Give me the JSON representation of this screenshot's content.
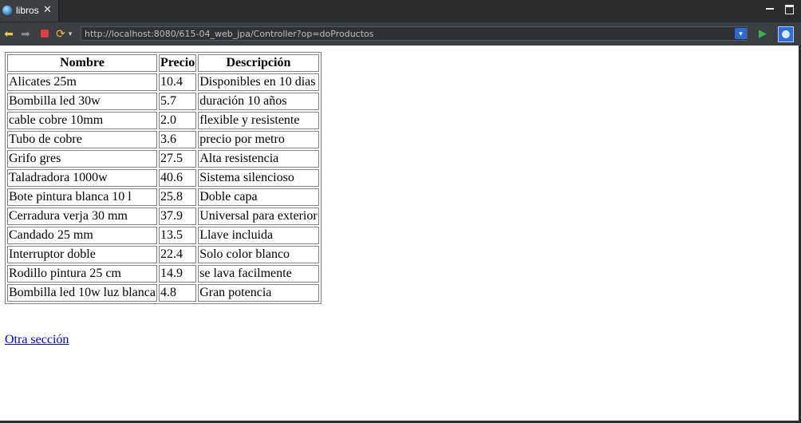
{
  "tab": {
    "title": "libros",
    "close": "✕"
  },
  "toolbar": {
    "url": "http://localhost:8080/615-04_web_jpa/Controller?op=doProductos"
  },
  "table": {
    "headers": [
      "Nombre",
      "Precio",
      "Descripción"
    ],
    "rows": [
      [
        "Alicates 25m",
        "10.4",
        "Disponibles en 10 dias"
      ],
      [
        "Bombilla led 30w",
        "5.7",
        "duración 10 años"
      ],
      [
        "cable cobre 10mm",
        "2.0",
        "flexible y resistente"
      ],
      [
        "Tubo de cobre",
        "3.6",
        "precio por metro"
      ],
      [
        "Grifo gres",
        "27.5",
        "Alta resistencia"
      ],
      [
        "Taladradora 1000w",
        "40.6",
        "Sistema silencioso"
      ],
      [
        "Bote pintura blanca 10 l",
        "25.8",
        "Doble capa"
      ],
      [
        "Cerradura verja 30 mm",
        "37.9",
        "Universal para exterior"
      ],
      [
        "Candado 25 mm",
        "13.5",
        "Llave incluida"
      ],
      [
        "Interruptor doble",
        "22.4",
        "Solo color blanco"
      ],
      [
        "Rodillo pintura 25 cm",
        "14.9",
        "se lava facilmente"
      ],
      [
        "Bombilla led 10w luz blanca",
        "4.8",
        "Gran potencia"
      ]
    ]
  },
  "link": {
    "label": "Otra sección"
  },
  "icons": {
    "tab": "globe-icon",
    "back": "back-arrow-icon",
    "forward": "forward-arrow-icon",
    "stop": "stop-icon",
    "refresh": "refresh-icon",
    "go": "go-icon",
    "browser": "browser-icon"
  },
  "colors": {
    "chrome": "#3c3f41",
    "link": "#0000ee",
    "go": "#3db34a",
    "stop": "#e23b3b"
  }
}
